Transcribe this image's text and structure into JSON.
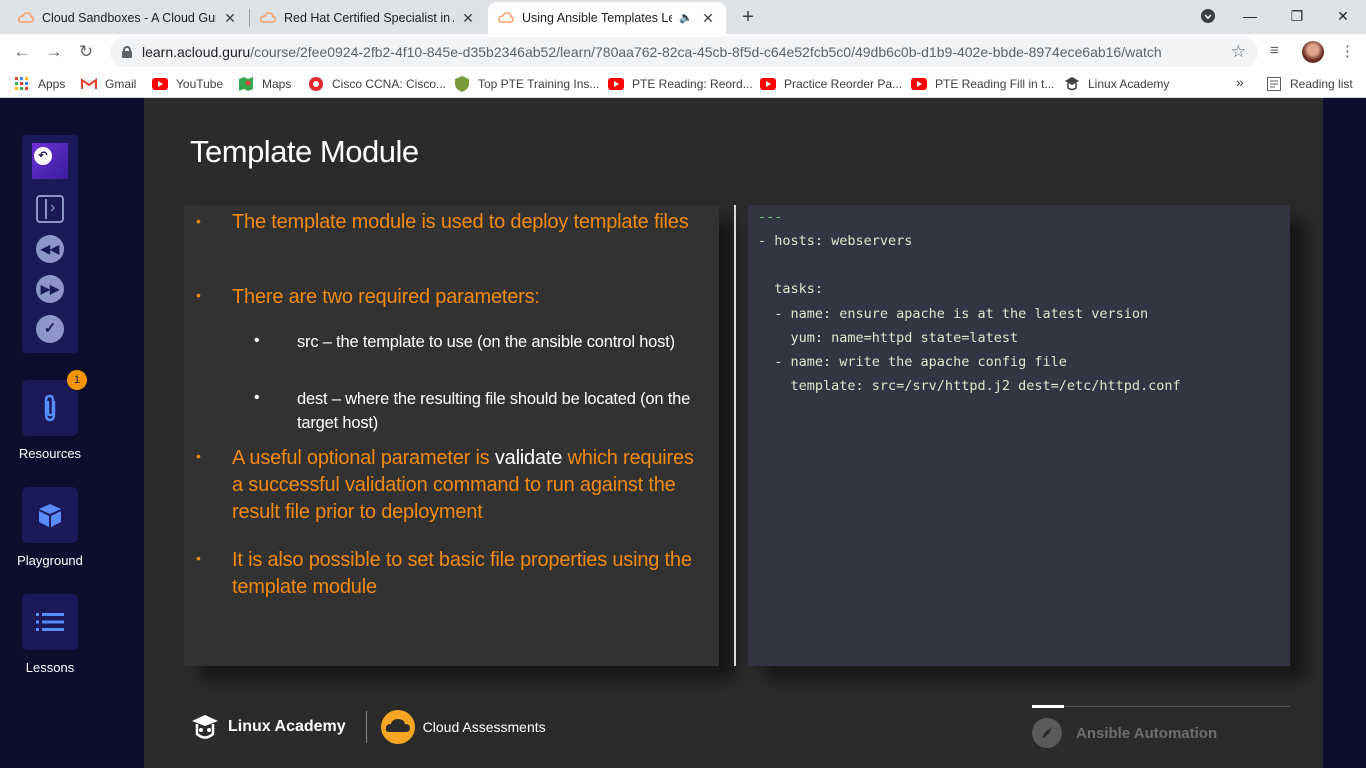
{
  "browser": {
    "tabs": [
      {
        "title": "Cloud Sandboxes - A Cloud Guru",
        "active": false
      },
      {
        "title": "Red Hat Certified Specialist in An",
        "active": false
      },
      {
        "title": "Using Ansible Templates Lect",
        "active": true
      }
    ],
    "new_tab": "+",
    "window_controls": {
      "minimize": "—",
      "restore": "❐",
      "close": "✕"
    },
    "url": {
      "host": "learn.acloud.guru",
      "path": "/course/2fee0924-2fb2-4f10-845e-d35b2346ab52/learn/780aa762-82ca-45cb-8f5d-c64e52fcb5c0/49db6c0b-d1b9-402e-bbde-8974ece6ab16/watch"
    },
    "bookmarks": [
      {
        "label": "Apps",
        "icon": "apps-grid-icon"
      },
      {
        "label": "Gmail",
        "icon": "gmail-icon"
      },
      {
        "label": "YouTube",
        "icon": "youtube-icon"
      },
      {
        "label": "Maps",
        "icon": "maps-icon"
      },
      {
        "label": "Cisco CCNA: Cisco...",
        "icon": "cisco-icon"
      },
      {
        "label": "Top PTE Training Ins...",
        "icon": "shield-icon"
      },
      {
        "label": "PTE Reading: Reord...",
        "icon": "youtube-icon"
      },
      {
        "label": "Practice Reorder Pa...",
        "icon": "youtube-icon"
      },
      {
        "label": "PTE Reading Fill in t...",
        "icon": "youtube-icon"
      },
      {
        "label": "Linux Academy",
        "icon": "linux-academy-icon"
      }
    ],
    "bookmarks_overflow": "»",
    "reading_list": "Reading list"
  },
  "sidebar": {
    "resources_label": "Resources",
    "resources_badge": "1",
    "playground_label": "Playground",
    "lessons_label": "Lessons"
  },
  "slide": {
    "title": "Template Module",
    "bullets": [
      {
        "text": "The template module is used to deploy template files"
      },
      {
        "text": "There are two required parameters:"
      },
      {
        "parts": [
          "A useful optional parameter is ",
          "validate",
          " which requires a successful validation command to run against the result file prior to deployment"
        ]
      },
      {
        "text": "It is also possible to set basic file properties using the template module"
      }
    ],
    "sub_bullets": [
      "src – the template to use (on the ansible control host)",
      "dest – where the resulting file should be located (on the target host)"
    ],
    "code": [
      "---",
      "- hosts: webservers",
      "",
      "  tasks:",
      "  - name: ensure apache is at the latest version",
      "    yum: name=httpd state=latest",
      "  - name: write the apache config file",
      "    template: src=/srv/httpd.j2 dest=/etc/httpd.conf"
    ],
    "footer": {
      "linux_academy": "Linux Academy",
      "cloud_assessments": "Cloud Assessments",
      "course": "Ansible Automation"
    }
  },
  "colors": {
    "accent_orange": "#f08a12",
    "nav_bg": "#0f0d2e",
    "tile_bg": "#1b1957",
    "code_bg": "#333542"
  }
}
